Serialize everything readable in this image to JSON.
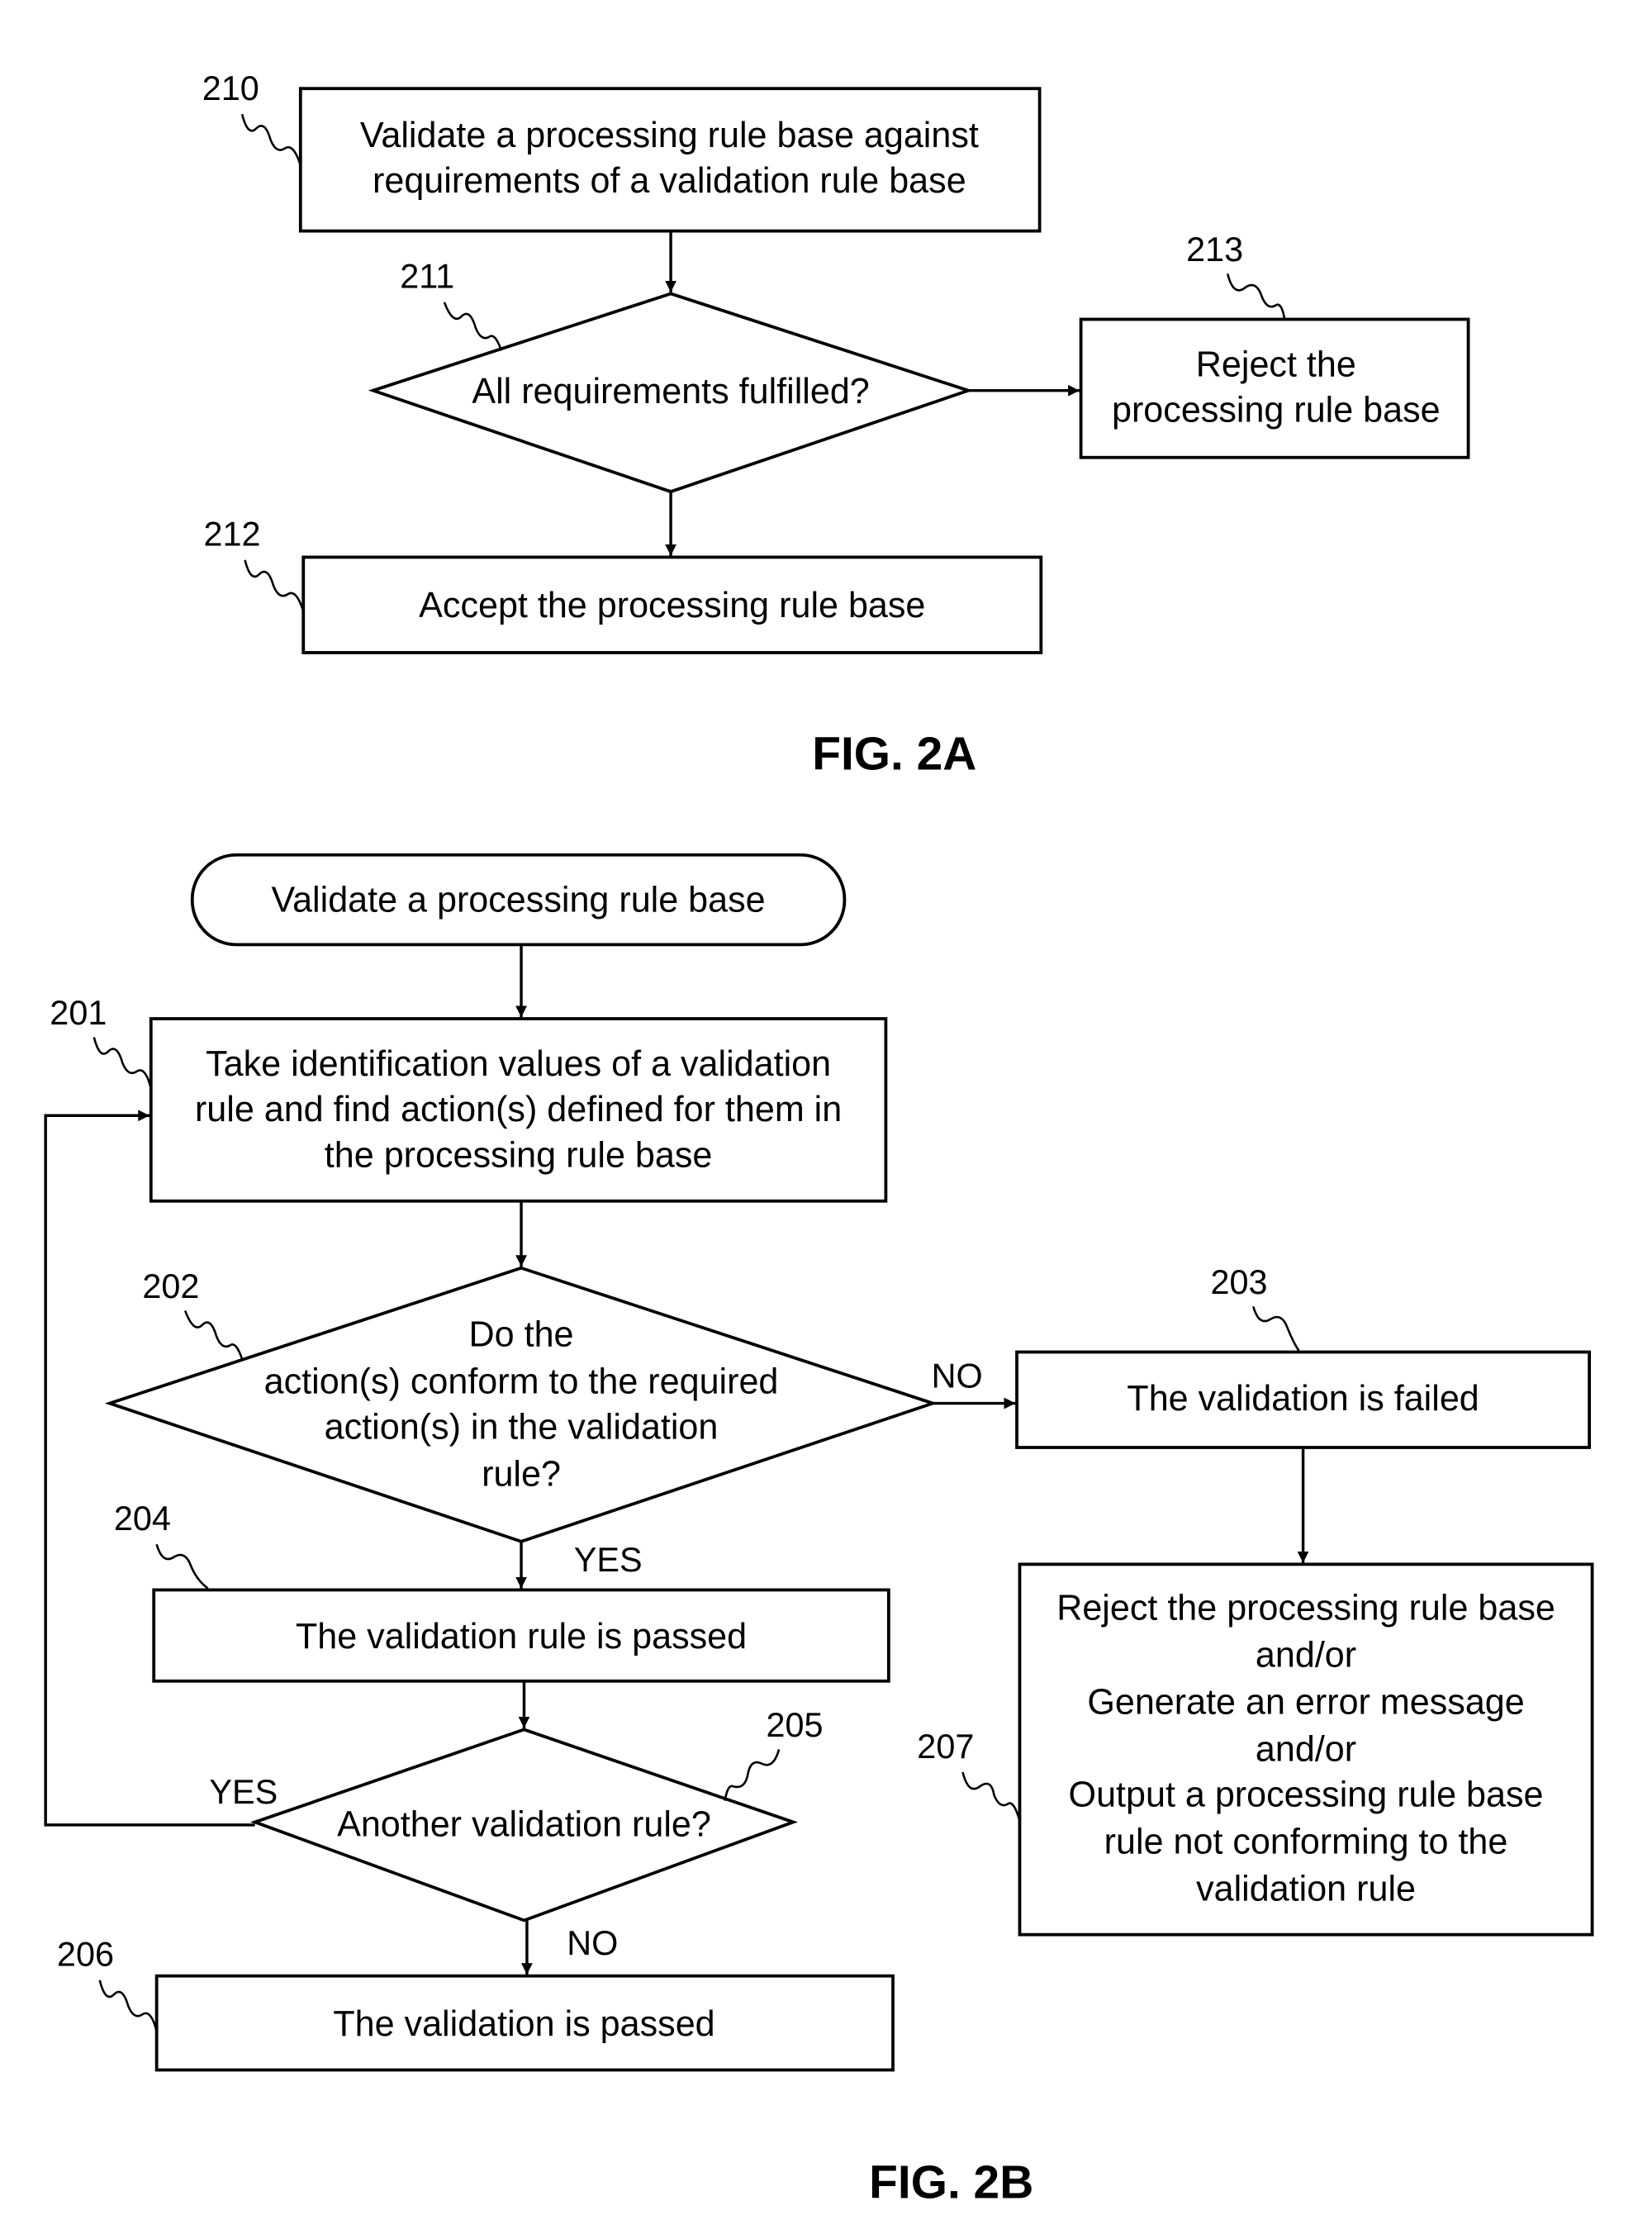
{
  "fig2a": {
    "caption": "FIG. 2A",
    "step210": {
      "ref": "210",
      "lines": [
        "Validate a processing rule base against",
        "requirements of a validation rule base"
      ]
    },
    "step211": {
      "ref": "211",
      "lines": [
        "All requirements fulfilled?"
      ]
    },
    "step212": {
      "ref": "212",
      "lines": [
        "Accept the processing rule base"
      ]
    },
    "step213": {
      "ref": "213",
      "lines": [
        "Reject the",
        "processing rule base"
      ]
    }
  },
  "fig2b": {
    "caption": "FIG. 2B",
    "start": {
      "lines": [
        "Validate a processing rule base"
      ]
    },
    "step201": {
      "ref": "201",
      "lines": [
        "Take identification values of a validation",
        "rule and find action(s) defined for them in",
        "the processing rule base"
      ]
    },
    "step202": {
      "ref": "202",
      "lines": [
        "Do the",
        "action(s) conform to the required",
        "action(s) in the validation",
        "rule?"
      ]
    },
    "step203": {
      "ref": "203",
      "lines": [
        "The validation is failed"
      ]
    },
    "step204": {
      "ref": "204",
      "lines": [
        "The validation rule is passed"
      ]
    },
    "step205": {
      "ref": "205",
      "lines": [
        "Another validation rule?"
      ]
    },
    "step206": {
      "ref": "206",
      "lines": [
        "The validation is passed"
      ]
    },
    "step207": {
      "ref": "207",
      "lines": [
        "Reject the processing rule base",
        "and/or",
        "Generate an error message",
        "and/or",
        "Output a processing rule base",
        "rule not conforming to the",
        "validation rule"
      ]
    },
    "labels": {
      "no_202": "NO",
      "yes_202": "YES",
      "yes_205": "YES",
      "no_205": "NO"
    }
  }
}
